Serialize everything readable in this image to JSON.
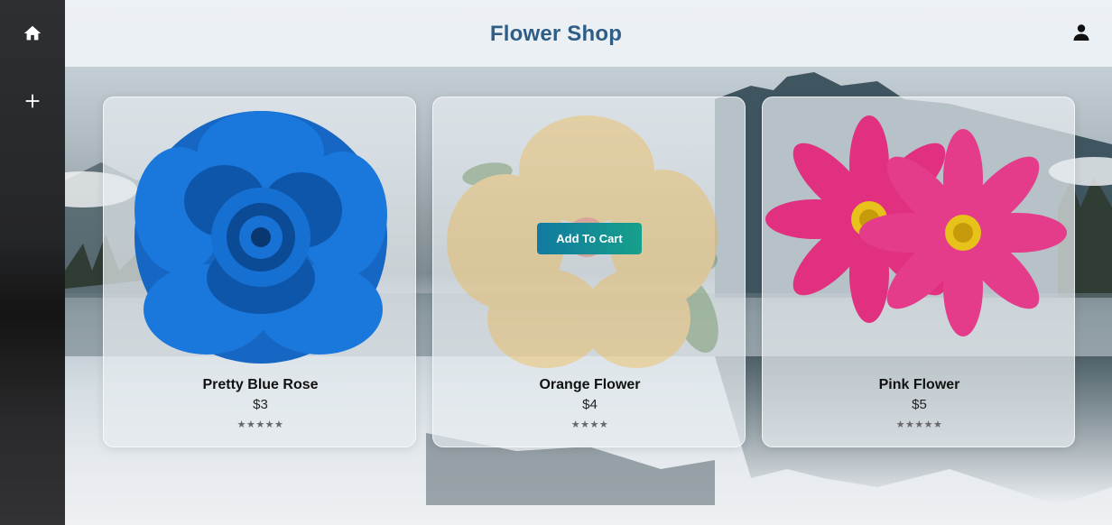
{
  "app": {
    "title": "Flower Shop"
  },
  "sidebar": {
    "items": [
      {
        "icon": "home-icon"
      },
      {
        "icon": "plus-icon"
      }
    ]
  },
  "header": {
    "profile_icon": "person-icon"
  },
  "products": [
    {
      "name": "Pretty Blue Rose",
      "price": "$3",
      "rating": 5,
      "stars": "★★★★★",
      "color": "#1a6fd0"
    },
    {
      "name": "Orange Flower",
      "price": "$4",
      "rating": 4,
      "stars": "★★★★",
      "color": "#f2b23a",
      "button": "Add To Cart"
    },
    {
      "name": "Pink Flower",
      "price": "$5",
      "rating": 5,
      "stars": "★★★★★",
      "color": "#e0307f"
    }
  ],
  "colors": {
    "title": "#2f5d85",
    "button_start": "#117aa0",
    "button_end": "#16a08b",
    "sidebar": "#252628"
  }
}
